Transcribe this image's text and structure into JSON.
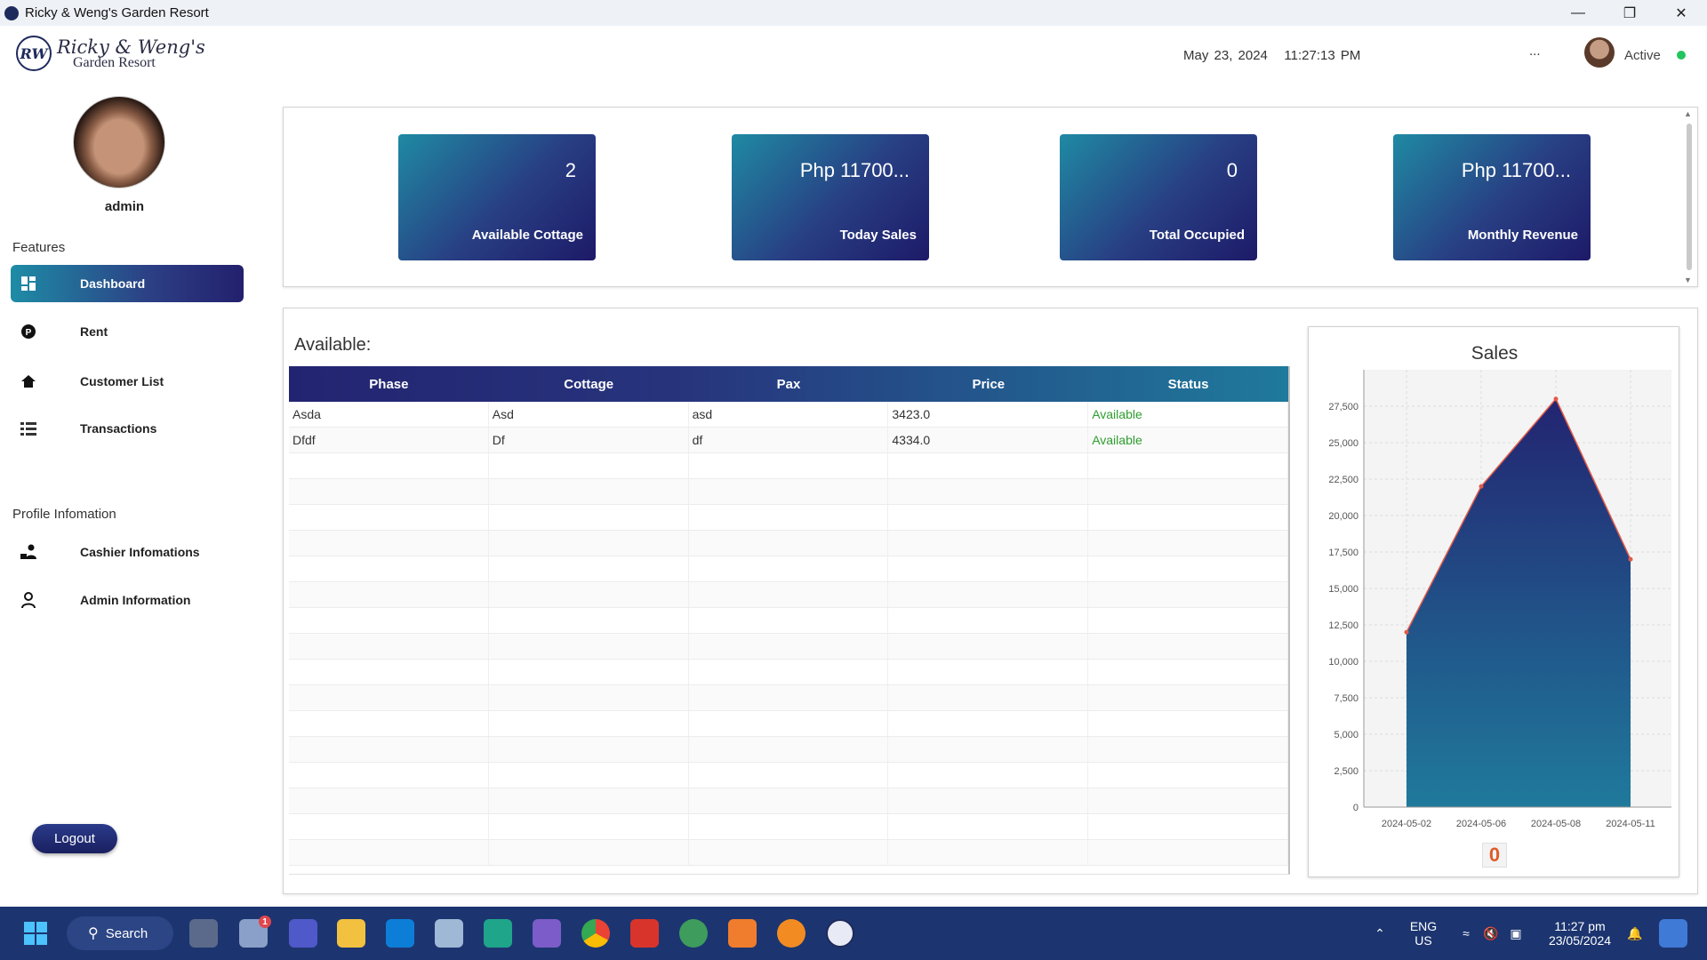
{
  "window": {
    "title": "Ricky & Weng's Garden Resort",
    "controls": [
      "minimize",
      "restore",
      "close"
    ]
  },
  "header": {
    "logo_mark": "RW",
    "logo_line1": "Ricky & Weng's",
    "logo_line2": "Garden Resort",
    "date": "May 23, 2024",
    "time": "11:27:13 PM",
    "more": "...",
    "user_status": "Active"
  },
  "sidebar": {
    "profile_name": "admin",
    "features_label": "Features",
    "items": [
      {
        "label": "Dashboard",
        "icon": "dashboard-icon",
        "active": true
      },
      {
        "label": "Rent",
        "icon": "rent-icon"
      },
      {
        "label": "Customer List",
        "icon": "home-icon"
      },
      {
        "label": "Transactions",
        "icon": "list-icon"
      }
    ],
    "profile_label": "Profile Infomation",
    "profile_items": [
      {
        "label": "Cashier Infomations",
        "icon": "cashier-icon"
      },
      {
        "label": "Admin Information",
        "icon": "admin-icon"
      }
    ],
    "logout_label": "Logout"
  },
  "stats": [
    {
      "value": "2",
      "label": "Available Cottage"
    },
    {
      "value": "Php 11700...",
      "label": "Today Sales"
    },
    {
      "value": "0",
      "label": "Total Occupied"
    },
    {
      "value": "Php 11700...",
      "label": "Monthly Revenue"
    }
  ],
  "available": {
    "title": "Available:",
    "columns": [
      "Phase",
      "Cottage",
      "Pax",
      "Price",
      "Status"
    ],
    "rows": [
      [
        "Asda",
        "Asd",
        "asd",
        "3423.0",
        "Available"
      ],
      [
        "Dfdf",
        "Df",
        "df",
        "4334.0",
        "Available"
      ]
    ],
    "status_color": "#2e9d2e"
  },
  "chart_data": {
    "type": "area",
    "title": "Sales",
    "x": [
      "2024-05-02",
      "2024-05-06",
      "2024-05-08",
      "2024-05-11"
    ],
    "values": [
      12000,
      22000,
      28000,
      17000
    ],
    "ylim": [
      0,
      30000
    ],
    "yticks": [
      0,
      2500,
      5000,
      7500,
      10000,
      12500,
      15000,
      17500,
      20000,
      22500,
      25000,
      27500
    ],
    "ytick_labels": [
      "0",
      "2,500",
      "5,000",
      "7,500",
      "10,000",
      "12,500",
      "15,000",
      "17,500",
      "20,000",
      "22,500",
      "25,000",
      "27,500"
    ],
    "grid": true,
    "fill_top": "#232471",
    "fill_bottom": "#1f7a9c",
    "line_color": "#e05a4a",
    "footer_value": "0"
  },
  "taskbar": {
    "search_label": "Search",
    "notification_badge": "1",
    "lang": "ENG",
    "region": "US",
    "clock_time": "11:27 pm",
    "clock_date": "23/05/2024",
    "apps": [
      "task-view-icon",
      "weather-icon",
      "teams-icon",
      "file-explorer-icon",
      "vscode-icon",
      "box-icon",
      "edge-icon",
      "visual-studio-icon",
      "chrome-icon",
      "wps-icon",
      "app-icon",
      "xampp-icon",
      "shield-icon",
      "resort-app-icon"
    ]
  },
  "colors": {
    "accent": "#283e83",
    "accent_teal": "#1f8aa3",
    "taskbar": "#1c3570",
    "active_dot": "#22c55e"
  }
}
